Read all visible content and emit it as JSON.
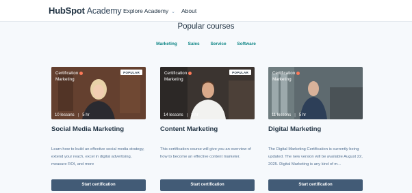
{
  "nav": {
    "logo_text": "HubSpot",
    "logo_suffix": "Academy",
    "explore": "Explore Academy",
    "about": "About"
  },
  "title": "Popular courses",
  "filters": [
    "Marketing",
    "Sales",
    "Service",
    "Software"
  ],
  "cards": [
    {
      "cert_label": "Certification",
      "category": "Marketing",
      "popular": "POPULAR",
      "lessons": "10 lessons",
      "duration": "5 hr",
      "title": "Social Media Marketing",
      "description": "Learn how to build an effective social media strategy, extend your reach, excel in digital advertising, measure ROI, and more",
      "button": "Start certification"
    },
    {
      "cert_label": "Certification",
      "category": "Marketing",
      "popular": "POPULAR",
      "lessons": "14 lessons",
      "duration": "8 hr",
      "title": "Content Marketing",
      "description": "This certification course will give you an overview of how to become an effective content marketer.",
      "button": "Start certification"
    },
    {
      "cert_label": "Certification",
      "category": "Marketing",
      "lessons": "11 lessons",
      "duration": "5 hr",
      "title": "Digital Marketing",
      "description": "The Digital Marketing Certification is currently being updated. The new version will be available August 22, 2025. Digital Marketing is any kind of m...",
      "button": "Start certification"
    }
  ],
  "colors": {
    "accent": "#ff7a59",
    "filter": "#0b8484",
    "button": "#425b76"
  }
}
